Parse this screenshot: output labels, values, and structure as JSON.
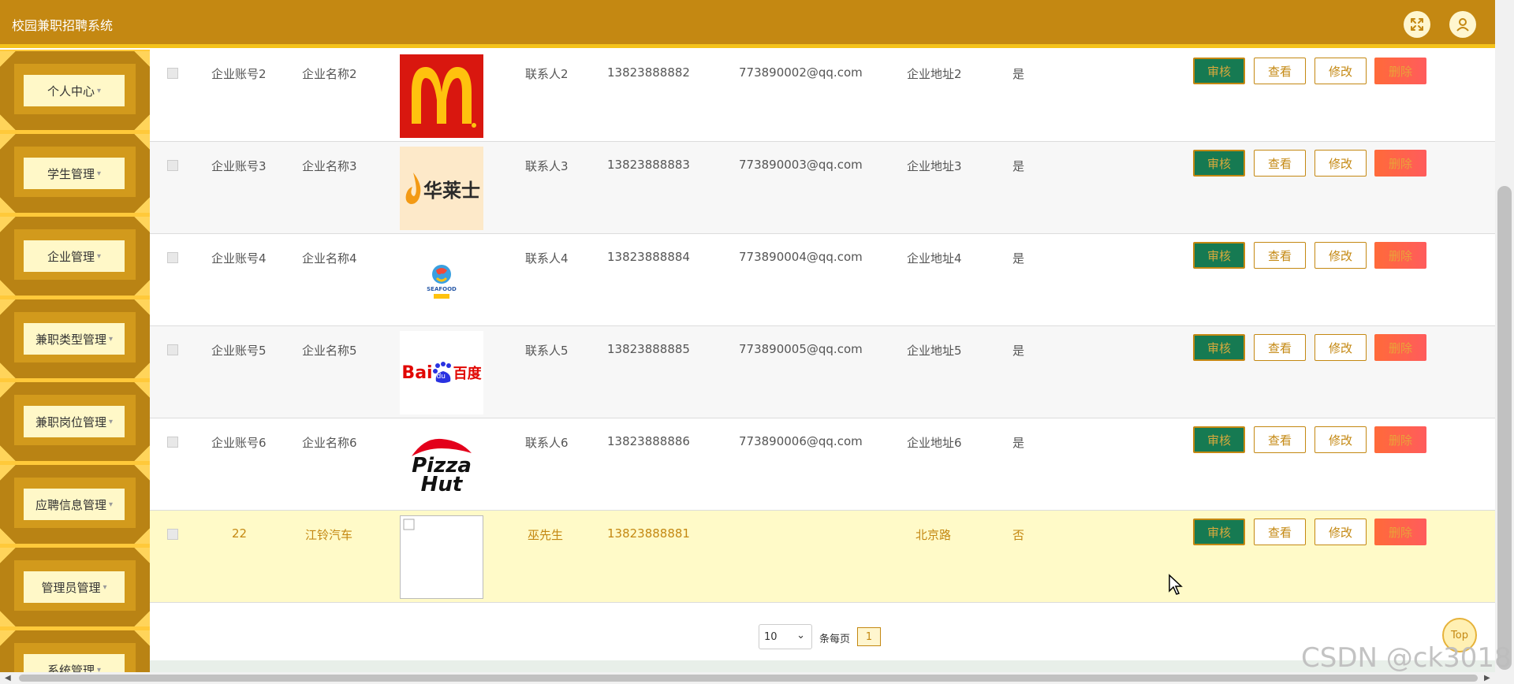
{
  "app": {
    "title": "校园兼职招聘系统"
  },
  "header": {
    "fullscreen_icon": "expand-arrows-icon",
    "user_icon": "user-icon"
  },
  "sidebar": {
    "items": [
      {
        "label": "个人中心"
      },
      {
        "label": "学生管理"
      },
      {
        "label": "企业管理"
      },
      {
        "label": "兼职类型管理"
      },
      {
        "label": "兼职岗位管理"
      },
      {
        "label": "应聘信息管理"
      },
      {
        "label": "管理员管理"
      },
      {
        "label": "系统管理"
      }
    ],
    "caret": "▾"
  },
  "table": {
    "rows": [
      {
        "account": "企业账号2",
        "name": "企业名称2",
        "logo": "mcdonalds",
        "contact": "联系人2",
        "phone": "13823888882",
        "email": "773890002@qq.com",
        "address": "企业地址2",
        "approved": "是"
      },
      {
        "account": "企业账号3",
        "name": "企业名称3",
        "logo": "wallace",
        "contact": "联系人3",
        "phone": "13823888883",
        "email": "773890003@qq.com",
        "address": "企业地址3",
        "approved": "是"
      },
      {
        "account": "企业账号4",
        "name": "企业名称4",
        "logo": "seafood",
        "contact": "联系人4",
        "phone": "13823888884",
        "email": "773890004@qq.com",
        "address": "企业地址4",
        "approved": "是"
      },
      {
        "account": "企业账号5",
        "name": "企业名称5",
        "logo": "baidu",
        "contact": "联系人5",
        "phone": "13823888885",
        "email": "773890005@qq.com",
        "address": "企业地址5",
        "approved": "是"
      },
      {
        "account": "企业账号6",
        "name": "企业名称6",
        "logo": "pizzahut",
        "contact": "联系人6",
        "phone": "13823888886",
        "email": "773890006@qq.com",
        "address": "企业地址6",
        "approved": "是"
      },
      {
        "account": "22",
        "name": "江铃汽车",
        "logo": "broken",
        "contact": "巫先生",
        "phone": "13823888881",
        "email": "",
        "address": "北京路",
        "approved": "否"
      }
    ],
    "actions": {
      "audit": "审核",
      "view": "查看",
      "edit": "修改",
      "delete": "删除"
    }
  },
  "logos": {
    "wallace_text": "华莱士",
    "seafood_text": "SEAFOOD",
    "baidu_text": "Bai",
    "baidu_paw": "du",
    "baidu_cn": "百度",
    "pizza_line1": "Pizza",
    "pizza_line2": "Hut"
  },
  "pagination": {
    "page_size": "10",
    "per_page_label": "条每页",
    "current_page": "1"
  },
  "top_button": "Top",
  "watermark": "CSDN @ck3018",
  "colors": {
    "header": "#c48812",
    "accent": "#f4c21a",
    "audit": "#167a52",
    "delete": "#ff5c5c",
    "highlight_row": "#fffac8"
  }
}
